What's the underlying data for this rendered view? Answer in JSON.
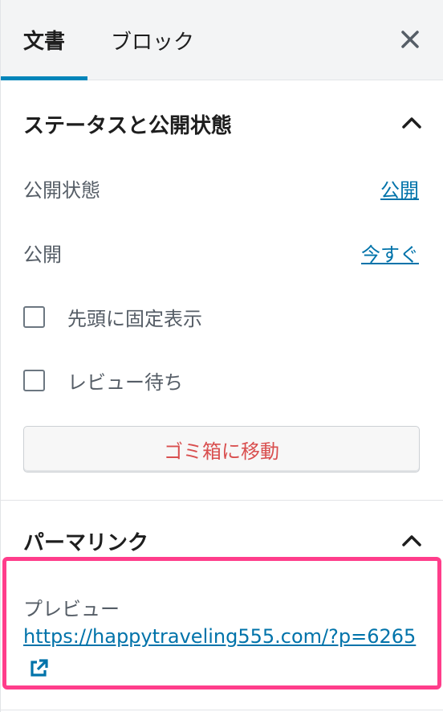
{
  "tabs": {
    "document": "文書",
    "block": "ブロック"
  },
  "status_section": {
    "title": "ステータスと公開状態",
    "visibility_label": "公開状態",
    "visibility_value": "公開",
    "publish_label": "公開",
    "publish_value": "今すぐ",
    "sticky_label": "先頭に固定表示",
    "pending_label": "レビュー待ち",
    "trash_label": "ゴミ箱に移動"
  },
  "permalink_section": {
    "title": "パーマリンク",
    "preview_label": "プレビュー",
    "url": "https://happytraveling555.com/?p=6265"
  },
  "colors": {
    "accent": "#0085ba",
    "link": "#0073aa",
    "danger": "#d94f4f",
    "highlight": "#ff3d8b"
  },
  "icons": {
    "close": "close-icon",
    "chevron": "chevron-up-icon",
    "external": "external-link-icon"
  }
}
